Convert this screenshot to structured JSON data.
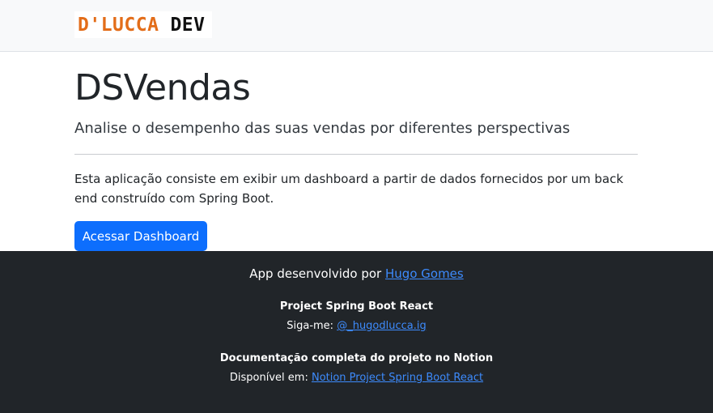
{
  "navbar": {
    "logo_part1": "D'LUCCA",
    "logo_part2": "DEV"
  },
  "hero": {
    "title": "DSVendas",
    "subtitle": "Analise o desempenho das suas vendas por diferentes perspectivas",
    "description": "Esta aplicação consiste em exibir um dashboard a partir de dados fornecidos por um back end construído com Spring Boot.",
    "button_label": "Acessar Dashboard"
  },
  "footer": {
    "dev_text": "App desenvolvido por",
    "dev_link": "Hugo Gomes",
    "project_title": "Project Spring Boot React",
    "follow_text": "Siga-me:",
    "follow_link": "@_hugodlucca.ig",
    "doc_title": "Documentação completa do projeto no Notion",
    "available_text": "Disponível em:",
    "available_link": "Notion Project Spring Boot React"
  },
  "colors": {
    "primary": "#0d6efd",
    "footer_bg": "#212529",
    "navbar_bg": "#f8f9fa",
    "logo_orange": "#e36d19"
  }
}
